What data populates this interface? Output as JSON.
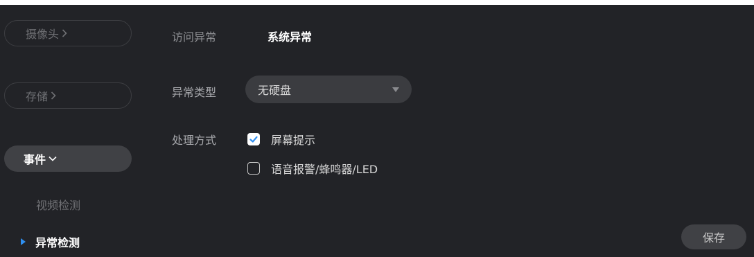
{
  "sidebar": {
    "camera": "摄像头",
    "storage": "存储",
    "event": "事件",
    "video_detect": "视频检测",
    "abnormal_detect": "异常检测"
  },
  "tabs": [
    {
      "label": "访问异常",
      "active": false
    },
    {
      "label": "系统异常",
      "active": true
    }
  ],
  "form": {
    "type_label": "异常类型",
    "type_value": "无硬盘",
    "handling_label": "处理方式",
    "options": [
      {
        "label": "屏幕提示",
        "checked": true
      },
      {
        "label": "语音报警/蜂鸣器/LED",
        "checked": false
      }
    ]
  },
  "save_label": "保存",
  "colors": {
    "background": "#222327",
    "accent": "#2f8ff0",
    "button": "#404145"
  },
  "icons": {
    "chevron_right": "chevron-right-icon",
    "chevron_down": "chevron-down-icon",
    "active_marker": "triangle-right-icon",
    "dropdown": "triangle-down-icon",
    "checkmark": "checkmark-icon"
  }
}
